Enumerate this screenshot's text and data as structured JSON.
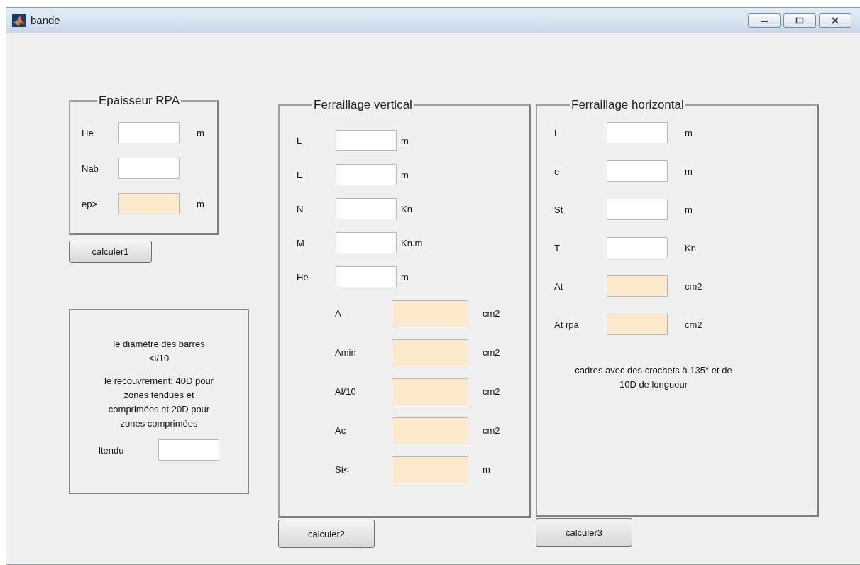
{
  "window": {
    "title": "bande"
  },
  "panels": [
    {
      "title": "Epaisseur RPA",
      "button": "calculer1",
      "rows": [
        {
          "label": "He",
          "kind": "input",
          "unit": "m"
        },
        {
          "label": "Nab",
          "kind": "input"
        },
        {
          "label": "ep>",
          "kind": "output",
          "unit": "m"
        }
      ]
    },
    {
      "title": "Ferraillage vertical",
      "button": "calculer2",
      "rows": [
        {
          "label": "L",
          "kind": "input",
          "unit": "m"
        },
        {
          "label": "E",
          "kind": "input",
          "unit": "m"
        },
        {
          "label": "N",
          "kind": "input",
          "unit": "Kn"
        },
        {
          "label": "M",
          "kind": "input",
          "unit": "Kn.m"
        },
        {
          "label": "He",
          "kind": "input",
          "unit": "m"
        },
        {
          "label": "A",
          "kind": "output",
          "unit": "cm2"
        },
        {
          "label": "Amin",
          "kind": "output",
          "unit": "cm2"
        },
        {
          "label": "Al/10",
          "kind": "output",
          "unit": "cm2"
        },
        {
          "label": "Ac",
          "kind": "output",
          "unit": "cm2"
        },
        {
          "label": "St<",
          "kind": "output",
          "unit": "m"
        }
      ]
    },
    {
      "title": "Ferraillage horizontal",
      "button": "calculer3",
      "note": "cadres avec des crochets à 135° et de 10D de longueur",
      "rows": [
        {
          "label": "L",
          "kind": "input",
          "unit": "m"
        },
        {
          "label": "e",
          "kind": "input",
          "unit": "m"
        },
        {
          "label": "St",
          "kind": "input",
          "unit": "m"
        },
        {
          "label": "T",
          "kind": "input",
          "unit": "Kn"
        },
        {
          "label": "At",
          "kind": "output",
          "unit": "cm2"
        },
        {
          "label": "At rpa",
          "kind": "output",
          "unit": "cm2"
        }
      ]
    }
  ],
  "info": {
    "paragraphs": [
      "le diamètre des barres <l/10",
      "le recouvrement: 40D pour zones tendues et comprimées et 20D pour zones comprimées"
    ],
    "field_label": "ltendu"
  }
}
